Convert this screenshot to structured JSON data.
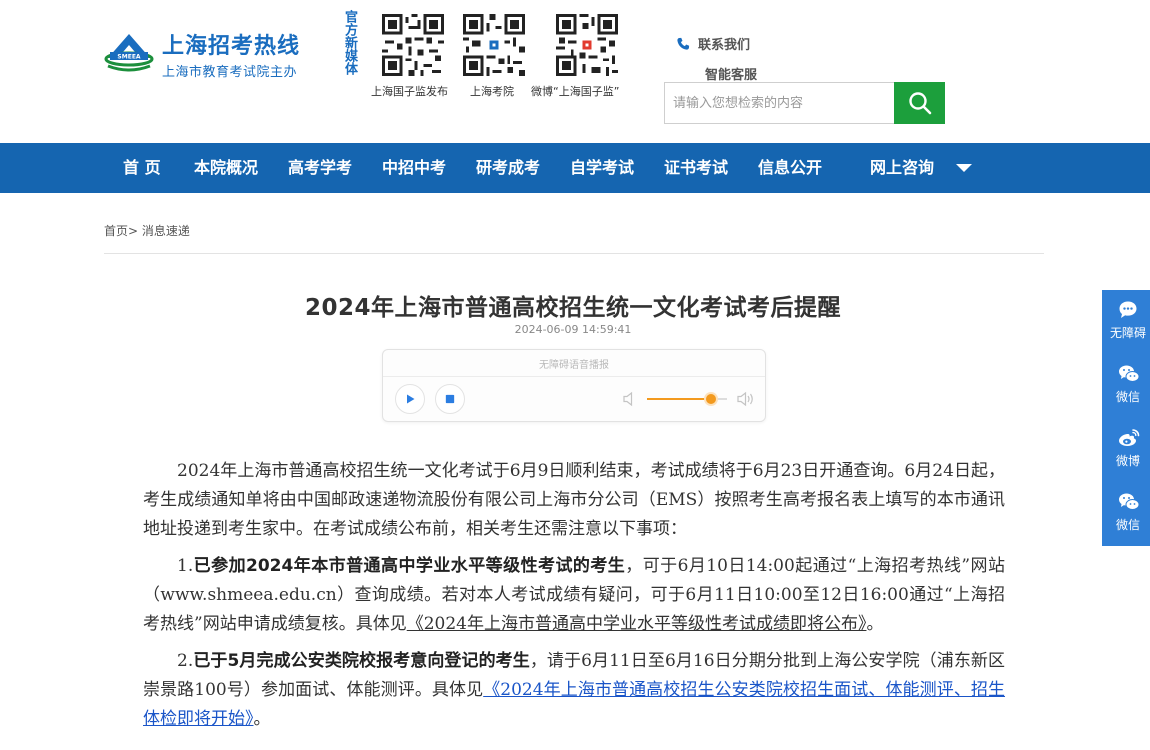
{
  "header": {
    "logo_title": "上海招考热线",
    "logo_subtitle": "上海市教育考试院主办",
    "new_media_label": "官方新媒体",
    "qr_codes": [
      {
        "label": "上海国子监发布"
      },
      {
        "label": "上海考院"
      },
      {
        "label": "微博“上海国子监”"
      }
    ],
    "contact_label": "联系我们",
    "service_label": "智能客服",
    "search_placeholder": "请输入您想检索的内容"
  },
  "nav": {
    "items": [
      "首 页",
      "本院概况",
      "高考学考",
      "中招中考",
      "研考成考",
      "自学考试",
      "证书考试",
      "信息公开",
      "网上咨询"
    ]
  },
  "breadcrumb": {
    "home": "首页",
    "separator": ">",
    "current": "消息速递"
  },
  "article": {
    "title": "2024年上海市普通高校招生统一文化考试考后提醒",
    "date": "2024-06-09 14:59:41",
    "player_label": "无障碍语音播报",
    "volume_level": 0.8,
    "intro": "2024年上海市普通高校招生统一文化考试于6月9日顺利结束，考试成绩将于6月23日开通查询。6月24日起，考生成绩通知单将由中国邮政速递物流股份有限公司上海市分公司（EMS）按照考生高考报名表上填写的本市通讯地址投递到考生家中。在考试成绩公布前，相关考生还需注意以下事项：",
    "item1_num": "1.",
    "item1_bold": "已参加2024年本市普通高中学业水平等级性考试的考生",
    "item1_text": "，可于6月10日14:00起通过“上海招考热线”网站（www.shmeea.edu.cn）查询成绩。若对本人考试成绩有疑问，可于6月11日10:00至12日16:00通过“上海招考热线”网站申请成绩复核。具体见",
    "item1_link": "《2024年上海市普通高中学业水平等级性考试成绩即将公布》",
    "item1_end": "。",
    "item2_num": "2.",
    "item2_bold": "已于5月完成公安类院校报考意向登记的考生",
    "item2_text": "，请于6月11日至6月16日分期分批到上海公安学院（浦东新区崇景路100号）参加面试、体能测评。具体见",
    "item2_link": "《2024年上海市普通高校招生公安类院校招生面试、体能测评、招生体检即将开始》",
    "item2_end": "。"
  },
  "sidebar": {
    "items": [
      {
        "label": "无障碍",
        "icon": "chat-bubble-icon"
      },
      {
        "label": "微信",
        "icon": "wechat-icon"
      },
      {
        "label": "微博",
        "icon": "weibo-icon"
      },
      {
        "label": "微信",
        "icon": "wechat-icon"
      }
    ]
  },
  "colors": {
    "nav_bg": "#1565b0",
    "brand_blue": "#1a6dbf",
    "search_green": "#1c9f3c",
    "sidebar_blue": "#2f7fd6",
    "volume_orange": "#f39a1e"
  }
}
